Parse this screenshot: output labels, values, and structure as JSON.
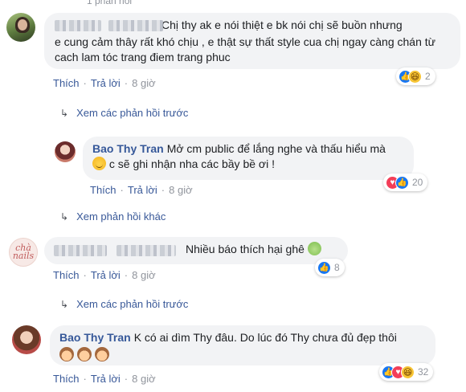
{
  "top_fragment": "1 phản hồi",
  "comments": [
    {
      "text_line1": "Chị thy ak e nói thiệt e bk nói chị sẽ buồn nhưng",
      "text_rest": "e cung cảm thây rất khó chịu , e thật sự thất style cua chị ngay càng chán từ cach lam tóc trang điem trang phuc",
      "actions": {
        "like": "Thích",
        "reply": "Trả lời",
        "time": "8 giờ"
      },
      "reactions": {
        "icons": [
          "like-icon",
          "haha-icon"
        ],
        "count": "2"
      }
    },
    {
      "name": "Bao Thy Tran",
      "text": "Mở cm public để lắng nghe và thấu hiểu mà",
      "text_line2": "c sẽ ghi nhận nha các bầy bề ơi !",
      "actions": {
        "like": "Thích",
        "reply": "Trả lời",
        "time": "8 giờ"
      },
      "reactions": {
        "icons": [
          "love-icon",
          "like-icon"
        ],
        "count": "20"
      }
    },
    {
      "text": "Nhiều báo thích hại ghê",
      "actions": {
        "like": "Thích",
        "reply": "Trả lời",
        "time": "8 giờ"
      },
      "reactions": {
        "icons": [
          "like-icon"
        ],
        "count": "8"
      }
    },
    {
      "name": "Bao Thy Tran",
      "text": "K có ai dìm Thy đâu. Do lúc đó Thy chưa đủ đẹp thôi",
      "actions": {
        "like": "Thích",
        "reply": "Trả lời",
        "time": "8 giờ"
      },
      "reactions": {
        "icons": [
          "like-icon",
          "love-icon",
          "haha-icon"
        ],
        "count": "32"
      }
    }
  ],
  "reply_links": [
    "Xem các phản hồi trước",
    "Xem phản hồi khác",
    "Xem các phản hồi trước"
  ],
  "avatar3_text": [
    "chà",
    "nails"
  ],
  "colors": {
    "link": "#385898",
    "name": "#365899",
    "bubble": "#f2f3f5",
    "meta": "#90949c"
  }
}
